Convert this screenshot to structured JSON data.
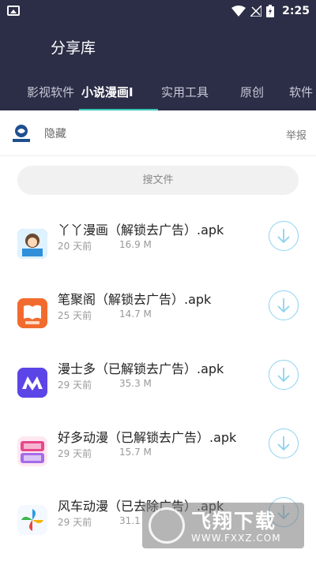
{
  "status_bar": {
    "time": "2:25"
  },
  "app_bar": {
    "title": "分享库"
  },
  "tabs": [
    {
      "label": "影视软件",
      "active": false
    },
    {
      "label": "小说漫画I",
      "active": true
    },
    {
      "label": "实用工具",
      "active": false
    },
    {
      "label": "原创",
      "active": false
    },
    {
      "label": "软件",
      "active": false
    }
  ],
  "owner": {
    "name": "隐藏",
    "report_label": "举报"
  },
  "search": {
    "label": "搜文件"
  },
  "files": [
    {
      "name": "丫丫漫画（解锁去广告）.apk",
      "age": "20 天前",
      "size": "16.9 M",
      "icon_color": "#2f8fd9"
    },
    {
      "name": "笔聚阁（解锁去广告）.apk",
      "age": "25 天前",
      "size": "14.7 M",
      "icon_color": "#f26b2e"
    },
    {
      "name": "漫士多（已解锁去广告）.apk",
      "age": "29 天前",
      "size": "35.3 M",
      "icon_color": "#5b45e6"
    },
    {
      "name": "好多动漫（已解锁去广告）.apk",
      "age": "29 天前",
      "size": "15.7 M",
      "icon_color": "#e8478b"
    },
    {
      "name": "风车动漫（已去除广告）.apk",
      "age": "29 天前",
      "size": "31.1",
      "icon_color": "#2c9be4"
    }
  ],
  "watermark": {
    "title": "飞翔下载",
    "url": "WWW.FXXZ.COM"
  },
  "colors": {
    "header_bg": "#2c2e47",
    "accent": "#37c5b7",
    "download_ring": "#8ed3f0"
  }
}
